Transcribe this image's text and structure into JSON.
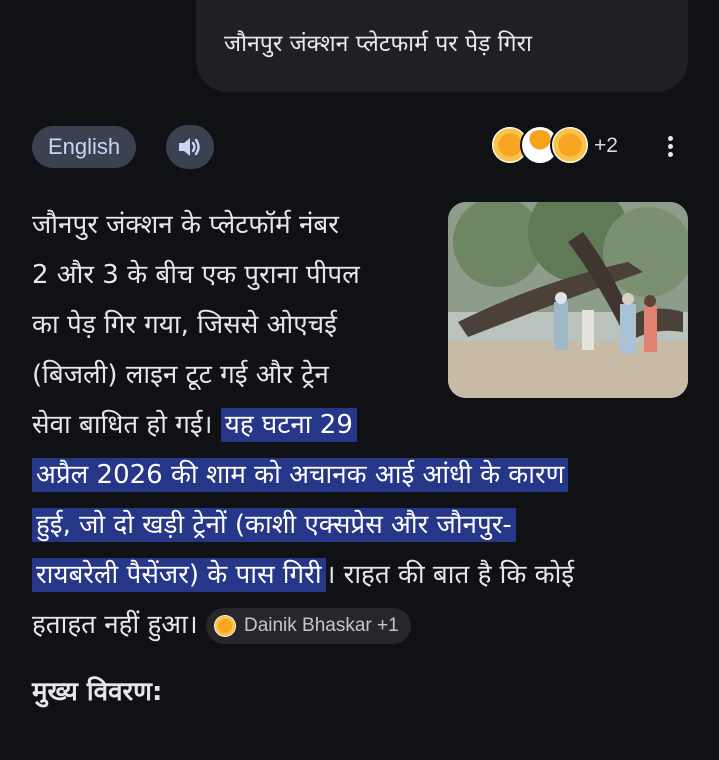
{
  "query": {
    "text": "जौनपुर जंक्शन प्लेटफार्म पर पेड़ गिरा"
  },
  "toolbar": {
    "language_label": "English",
    "speaker_icon": "speaker-icon",
    "source_count": "+2",
    "more_icon": "more-vertical-icon",
    "source_logos": [
      "dainik-bhaskar-logo",
      "amar-ujala-logo",
      "dainik-bhaskar-logo"
    ]
  },
  "answer": {
    "lines": [
      "जौनपुर जंक्शन के प्लेटफॉर्म नंबर",
      "2 और 3 के बीच एक पुराना पीपल",
      "का पेड़ गिर गया, जिससे ओएचई",
      "(बिजली) लाइन टूट गई और ट्रेन"
    ],
    "line5_plain": "सेवा बाधित हो गई। ",
    "line5_highlight": "यह घटना 29",
    "line6_highlight": "अप्रैल 2026 की शाम को अचानक आई आंधी के कारण",
    "line7_highlight": "हुई, जो दो खड़ी ट्रेनों (काशी एक्सप्रेस और जौनपुर-",
    "line8_highlight": "रायबरेली पैसेंजर) के पास गिरी",
    "line8_plain": "। राहत की बात है कि कोई",
    "line9_plain": "हताहत नहीं हुआ। ",
    "citation": {
      "label": "Dainik Bhaskar +1"
    }
  },
  "section": {
    "heading": "मुख्य विवरण:"
  },
  "colors": {
    "background": "#101114",
    "bubble": "#1f2024",
    "chip": "#3a4150",
    "highlight": "#26378a"
  }
}
